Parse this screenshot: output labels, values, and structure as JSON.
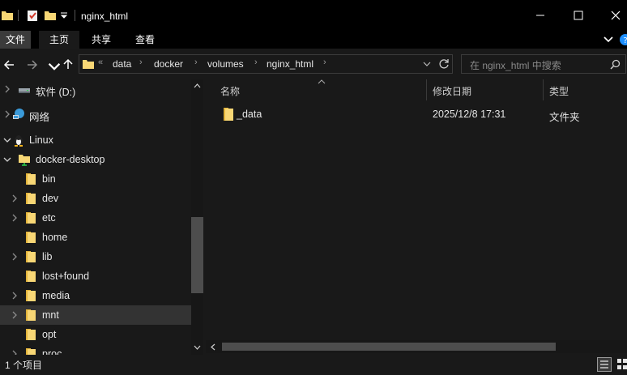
{
  "window": {
    "title": "nginx_html",
    "controls": {
      "minimize": "minimize-icon",
      "maximize": "maximize-icon",
      "close": "close-icon"
    }
  },
  "ribbon": {
    "tabs": [
      {
        "label": "文件",
        "active": true
      },
      {
        "label": "主页"
      },
      {
        "label": "共享"
      },
      {
        "label": "查看"
      }
    ]
  },
  "address": {
    "overflow": "«",
    "crumbs": [
      "data",
      "docker",
      "volumes",
      "nginx_html"
    ]
  },
  "search": {
    "placeholder": "在 nginx_html 中搜索"
  },
  "nav": {
    "items": [
      {
        "label": "软件 (D:)",
        "icon": "drive-icon"
      },
      {
        "label": "网络",
        "icon": "network-icon"
      },
      {
        "label": "Linux",
        "icon": "linux-icon"
      },
      {
        "label": "docker-desktop",
        "icon": "folder-icon"
      },
      {
        "label": "bin",
        "icon": "folder-icon"
      },
      {
        "label": "dev",
        "icon": "folder-icon"
      },
      {
        "label": "etc",
        "icon": "folder-icon"
      },
      {
        "label": "home",
        "icon": "folder-icon"
      },
      {
        "label": "lib",
        "icon": "folder-icon"
      },
      {
        "label": "lost+found",
        "icon": "folder-icon"
      },
      {
        "label": "media",
        "icon": "folder-icon"
      },
      {
        "label": "mnt",
        "icon": "folder-icon"
      },
      {
        "label": "opt",
        "icon": "folder-icon"
      },
      {
        "label": "proc",
        "icon": "folder-icon"
      }
    ]
  },
  "columns": {
    "name": "名称",
    "date": "修改日期",
    "type": "类型"
  },
  "files": [
    {
      "name": "_data",
      "date": "2025/12/8 17:31",
      "type": "文件夹"
    }
  ],
  "status": {
    "count": "1 个项目"
  },
  "colors": {
    "folder": "#f8d775",
    "folder_dark": "#e2b33a",
    "selection": "#333333"
  }
}
